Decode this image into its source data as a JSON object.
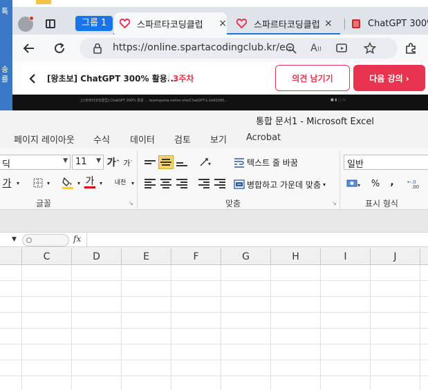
{
  "desktop": {
    "side_chars": [
      "톡",
      "송",
      "를"
    ]
  },
  "browser": {
    "tab_group": "그룹 1",
    "tabs": [
      {
        "title": "스파르타코딩클럽",
        "close": "×"
      },
      {
        "title": "스파르타코딩클럽",
        "close": "×"
      },
      {
        "title": "ChatGPT 300%"
      }
    ],
    "url": "https://online.spartacodingclub.kr/e..."
  },
  "webpage": {
    "course_title": "[왕초보] ChatGPT 300% 활용...",
    "week": "3주차",
    "feedback_button": "의견 남기기",
    "next_button": "다음 강의 ›",
    "video_caption": "[스파르타코딩클럽] ChatGPT 300% 활용 ... teamsparta.notion.site/ChatGPT-1-1e91095..."
  },
  "excel": {
    "title": "통합 문서1  -  Microsoft Excel",
    "menu": [
      "페이지 레이아웃",
      "수식",
      "데이터",
      "검토",
      "보기",
      "Acrobat"
    ],
    "ribbon": {
      "font_name": "딕",
      "font_size": "11",
      "grow_font": "가",
      "shrink_font": "가",
      "underline_btn": "가",
      "font_color_btn": "가",
      "phonetic_btn": "내천",
      "wrap_text": "텍스트 줄 바꿈",
      "merge_center": "병합하고 가운데 맞춤",
      "number_format": "일반",
      "percent": "%",
      "comma": ",",
      "group_font": "글꼴",
      "group_alignment": "맞춤",
      "group_number": "표시 형식"
    },
    "fx_label": "fx",
    "columns": [
      "C",
      "D",
      "E",
      "F",
      "G",
      "H",
      "I",
      "J"
    ]
  },
  "colors": {
    "accent": "#e8344e",
    "browser_blue": "#1a73e8",
    "selected_align": "#f7d46a"
  }
}
